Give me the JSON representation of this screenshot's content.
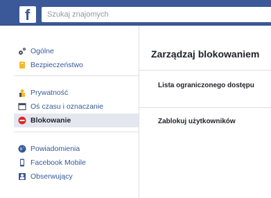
{
  "topbar": {
    "logo_letter": "f",
    "search_placeholder": "Szukaj znajomych"
  },
  "sidebar": {
    "groups": [
      {
        "items": [
          {
            "label": "Ogólne",
            "icon": "gear-icon"
          },
          {
            "label": "Bezpieczeństwo",
            "icon": "shield-icon"
          }
        ]
      },
      {
        "items": [
          {
            "label": "Prywatność",
            "icon": "lock-person-icon"
          },
          {
            "label": "Oś czasu i oznaczanie",
            "icon": "timeline-icon"
          },
          {
            "label": "Blokowanie",
            "icon": "block-icon",
            "active": true
          }
        ]
      },
      {
        "items": [
          {
            "label": "Powiadomienia",
            "icon": "globe-icon"
          },
          {
            "label": "Facebook Mobile",
            "icon": "mobile-icon"
          },
          {
            "label": "Obserwujący",
            "icon": "followers-icon"
          }
        ]
      }
    ]
  },
  "main": {
    "title": "Zarządzaj blokowaniem",
    "rows": [
      {
        "label": "Lista ograniczonego dostępu"
      },
      {
        "label": "Zablokuj użytkowników"
      }
    ]
  },
  "colors": {
    "brand": "#3b5998",
    "active_bg": "#e4e7ef",
    "block_red": "#e0242b"
  }
}
